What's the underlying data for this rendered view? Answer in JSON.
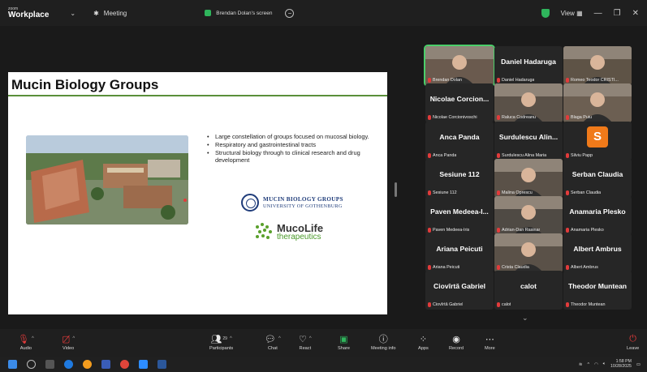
{
  "titlebar": {
    "brand_small": "zoom",
    "brand_big": "Workplace",
    "meeting_label": "Meeting",
    "screen_label": "Brendan Dolan's screen",
    "view_label": "View",
    "colors": {
      "accent_green": "#2fb55c"
    }
  },
  "slide": {
    "title": "Mucin Biology Groups",
    "bullets": [
      "Large constellation of groups focused on mucosal biology.",
      "Respiratory and gastrointestinal tracts",
      "Structural biology through to clinical research and drug development"
    ],
    "logo1_line1": "MUCIN BIOLOGY GROUPS",
    "logo1_line2": "UNIVERSITY OF GOTHENBURG",
    "logo2_line1": "MucoLife",
    "logo2_line2": "therapeutics"
  },
  "gallery": {
    "tiles": [
      {
        "name": "",
        "label": "Brendan Dolan",
        "kind": "photo",
        "active": true
      },
      {
        "name": "Daniel Hadaruga",
        "label": "Daniel Hadaruga",
        "kind": "name"
      },
      {
        "name": "",
        "label": "Romeo Teodor CRISTI...",
        "kind": "photo"
      },
      {
        "name": "Nicolae Corcion...",
        "label": "Nicolae Corcionivoschi",
        "kind": "name"
      },
      {
        "name": "",
        "label": "Raluca Codreanu",
        "kind": "photo"
      },
      {
        "name": "",
        "label": "Blaga Puiu",
        "kind": "photo"
      },
      {
        "name": "Anca Panda",
        "label": "Anca Panda",
        "kind": "name"
      },
      {
        "name": "Surdulescu Alin...",
        "label": "Surdulescu Alina Maria",
        "kind": "name"
      },
      {
        "name": "S",
        "label": "Silviu Papp",
        "kind": "avatar"
      },
      {
        "name": "Sesiune 112",
        "label": "Sesiune 112",
        "kind": "name"
      },
      {
        "name": "",
        "label": "Malina Oprescu",
        "kind": "photo"
      },
      {
        "name": "Serban Claudia",
        "label": "Serban Claudia",
        "kind": "name"
      },
      {
        "name": "Paven Medeea-I...",
        "label": "Paven Medeea-Iris",
        "kind": "name"
      },
      {
        "name": "",
        "label": "Adrian-Dan Rasinar",
        "kind": "photo"
      },
      {
        "name": "Anamaria Plesko",
        "label": "Anamaria Plesko",
        "kind": "name"
      },
      {
        "name": "Ariana Peicuti",
        "label": "Ariana Peicuti",
        "kind": "name"
      },
      {
        "name": "",
        "label": "Crista Claudia",
        "kind": "photo"
      },
      {
        "name": "Albert Ambrus",
        "label": "Albert Ambrus",
        "kind": "name"
      },
      {
        "name": "Ciovîrtă Gabriel",
        "label": "Ciovîrtă Gabriel",
        "kind": "name"
      },
      {
        "name": "calot",
        "label": "calot",
        "kind": "name"
      },
      {
        "name": "Theodor Muntean",
        "label": "Theodor Muntean",
        "kind": "name"
      }
    ]
  },
  "toolbar": {
    "audio": "Audio",
    "video": "Video",
    "participants": "Participants",
    "participants_count": "29",
    "chat": "Chat",
    "react": "React",
    "share": "Share",
    "meeting_info": "Meeting info",
    "apps": "Apps",
    "record": "Record",
    "more": "More",
    "leave": "Leave"
  },
  "taskbar": {
    "time": "1:58 PM",
    "date": "10/28/2025"
  }
}
